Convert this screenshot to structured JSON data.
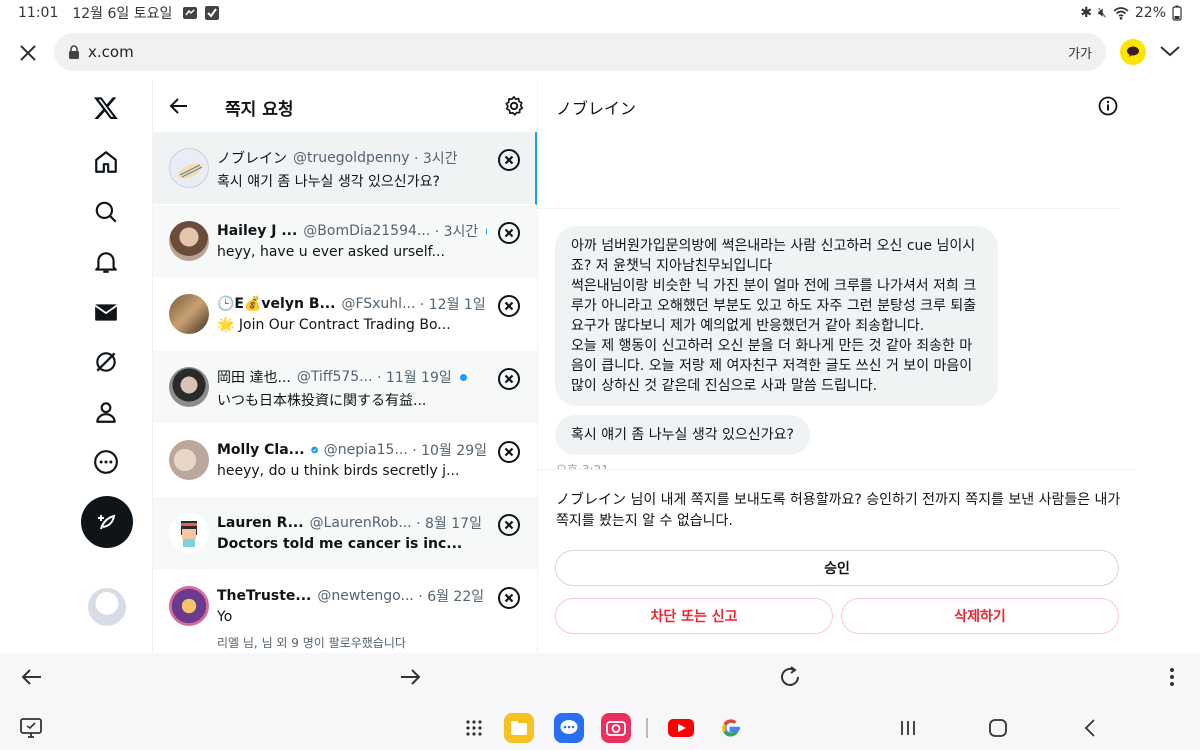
{
  "status_bar": {
    "time": "11:01",
    "date": "12월 6일 토요일",
    "battery": "22%"
  },
  "browser": {
    "url": "x.com",
    "translate_label": "가가"
  },
  "list": {
    "title": "쪽지 요청",
    "rows": [
      {
        "name": "ノブレイン",
        "handle": "@truegoldpenny",
        "time": "· 3시간",
        "preview": "혹시 얘기 좀 나누실 생각 있으신가요?",
        "unread": false
      },
      {
        "name": "Hailey J ...",
        "handle": "@BomDia21594...",
        "time": "· 3시간",
        "preview": "heyy, have u ever asked urself...",
        "unread": true
      },
      {
        "name": "🕒E💰velyn B...",
        "handle": "@FSxuhl...",
        "time": "· 12월 1일",
        "preview": "🌟 Join Our Contract Trading Bo...",
        "unread": false
      },
      {
        "name": "岡田 達也...",
        "handle": "@Tiff575...",
        "time": "· 11월 19일",
        "preview": "いつも日本株投資に関する有益...",
        "unread": true
      },
      {
        "name": "Molly Cla...",
        "handle": "@nepia15...",
        "time": "· 10월 29일",
        "preview": "heeyy, do u think birds secretly j...",
        "unread": false
      },
      {
        "name": "Lauren R...",
        "handle": "@LaurenRob...",
        "time": "· 8월 17일",
        "preview": "Doctors told me cancer is inc...",
        "unread": true
      },
      {
        "name": "TheTruste...",
        "handle": "@newtengo...",
        "time": "· 6월 22일",
        "preview": "Yo",
        "unread": true,
        "followers": "리엘 님, 님 외 9 명이 팔로우했습니다"
      }
    ]
  },
  "chat": {
    "name": "ノブレイン",
    "message1": "아까 넘버원가입문의방에 썩은내라는 사람 신고하러 오신 cue 님이시죠? 저 윤챗닉 지아남친무뇌입니다\n썩은내님이랑 비슷한 닉 가진 분이 얼마 전에 크루를 나가셔서 저희 크루가 아니라고 오해했던 부분도 있고 하도 자주 그런 분탕성 크루 퇴출 요구가 많다보니 제가 예의없게 반응했던거 같아 죄송합니다.\n오늘 제 행동이 신고하러 오신 분을 더 화나게 만든 것 같아 죄송한 마음이 큽니다. 오늘 저랑 제 여자친구 저격한 글도 쓰신 거 보이 마음이 많이 상하신 것 같은데 진심으로 사과 말씀 드립니다.",
    "message2": "혹시 얘기 좀 나누실 생각 있으신가요?",
    "msg_time": "오후 3:21",
    "request_text": "ノブレイン 님이 내게 쪽지를 보내도록 허용할까요? 승인하기 전까지 쪽지를 보낸 사람들은 내가 쪽지를 봤는지 알 수 없습니다.",
    "accept_label": "승인",
    "block_label": "차단 또는 신고",
    "delete_label": "삭제하기"
  },
  "colors": {
    "accent": "#1d9bf0",
    "danger": "#f4212e",
    "text": "#0f1419",
    "muted": "#536471"
  }
}
